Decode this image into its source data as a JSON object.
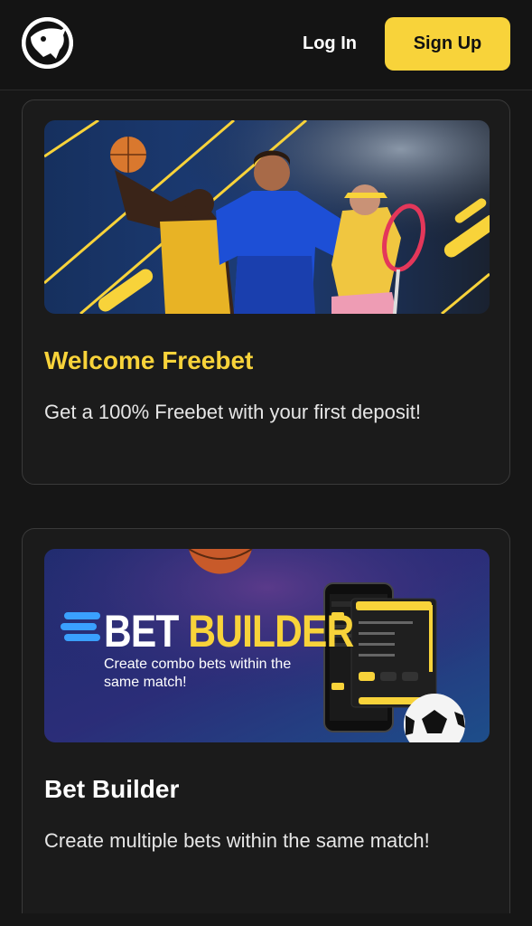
{
  "header": {
    "login_label": "Log In",
    "signup_label": "Sign Up"
  },
  "promos": [
    {
      "title": "Welcome Freebet",
      "description": "Get a 100% Freebet with your first deposit!"
    },
    {
      "title": "Bet Builder",
      "description": "Create multiple bets within the same match!",
      "banner": {
        "title_bet": "BET",
        "title_builder": "BUILDER",
        "subtitle": "Create combo bets within the same match!"
      }
    }
  ],
  "colors": {
    "background": "#161616",
    "accent": "#f8d33a",
    "card_border": "#3a3a3a"
  }
}
